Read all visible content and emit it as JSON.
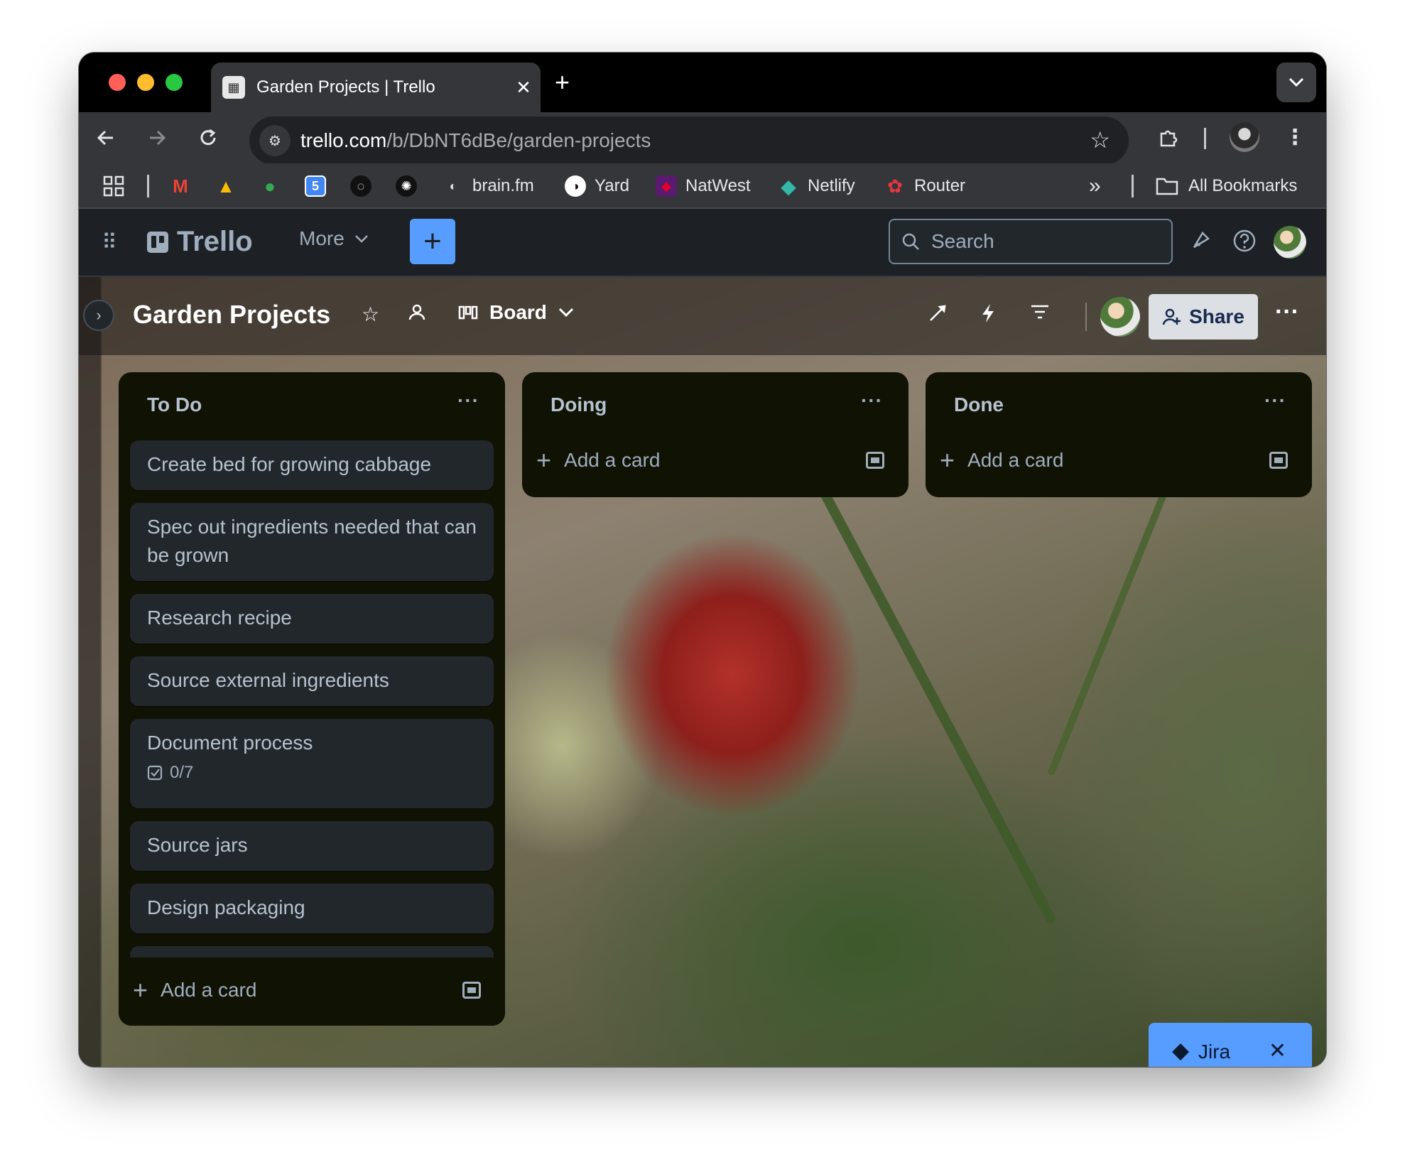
{
  "browser": {
    "tab": {
      "title": "Garden Projects | Trello",
      "close_glyph": "✕",
      "favicon": "trello-favicon"
    },
    "new_tab_glyph": "+",
    "tab_menu_glyph": "⌄",
    "url": {
      "host": "trello.com",
      "path": "/b/DbNT6dBe/garden-projects"
    },
    "bookmarks": [
      {
        "label": "brain.fm",
        "icon": "brainfm-icon"
      },
      {
        "label": "Yard",
        "icon": "yard-icon"
      },
      {
        "label": "NatWest",
        "icon": "natwest-icon"
      },
      {
        "label": "Netlify",
        "icon": "netlify-icon"
      },
      {
        "label": "Router",
        "icon": "router-icon"
      }
    ],
    "bookmark_icons_only": [
      "apps-grid-icon",
      "gmail-icon",
      "google-drive-icon",
      "google-maps-icon",
      "google-calendar-icon",
      "chat-icon",
      "openai-icon"
    ],
    "calendar_day": "5",
    "overflow_glyph": "»",
    "all_bookmarks": "All Bookmarks"
  },
  "trello": {
    "logo": "Trello",
    "more": "More",
    "create_glyph": "+",
    "search_placeholder": "Search"
  },
  "board": {
    "title": "Garden Projects",
    "view": "Board",
    "share": "Share",
    "more_glyph": "···"
  },
  "lists": [
    {
      "title": "To Do",
      "cards": [
        {
          "title": "Create bed for growing cabbage"
        },
        {
          "title": "Spec out ingredients needed that can be grown"
        },
        {
          "title": "Research recipe"
        },
        {
          "title": "Source external ingredients"
        },
        {
          "title": "Document process",
          "checklist": "0/7"
        },
        {
          "title": "Source jars"
        },
        {
          "title": "Design packaging"
        }
      ],
      "add_card": "Add a card"
    },
    {
      "title": "Doing",
      "cards": [],
      "add_card": "Add a card"
    },
    {
      "title": "Done",
      "cards": [],
      "add_card": "Add a card"
    }
  ],
  "list_menu_glyph": "···",
  "jira": {
    "label": "Jira",
    "close_glyph": "✕"
  },
  "colors": {
    "accent_blue": "#579dff",
    "list_bg": "#101204",
    "card_bg": "#22272b",
    "header_bg": "#1d2125"
  }
}
